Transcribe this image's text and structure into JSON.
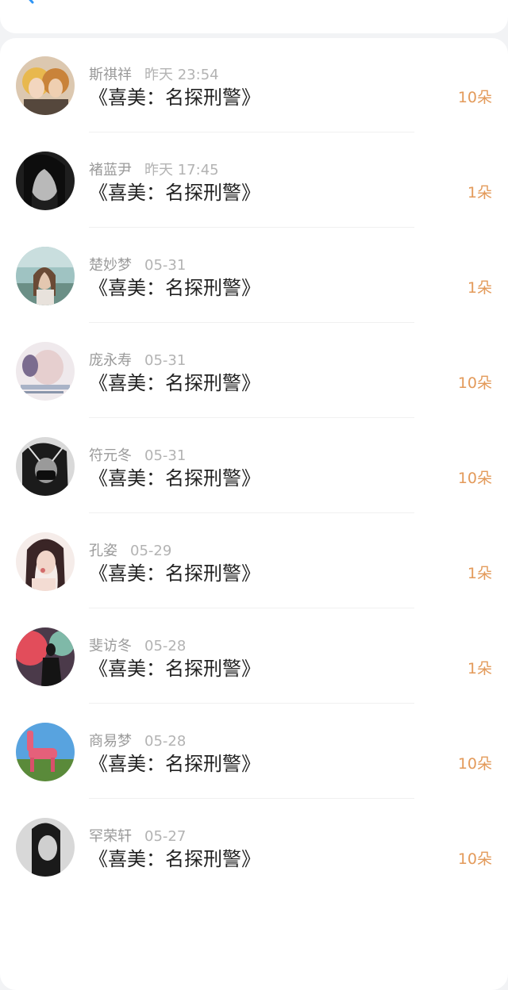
{
  "header": {
    "back_icon": "chevron-left-icon",
    "accent_color": "#2f95f5"
  },
  "records": [
    {
      "name": "斯祺祥",
      "time": "昨天 23:54",
      "title": "《喜美：名探刑警》",
      "amount": "10朵"
    },
    {
      "name": "褚蓝尹",
      "time": "昨天 17:45",
      "title": "《喜美：名探刑警》",
      "amount": "1朵"
    },
    {
      "name": "楚妙梦",
      "time": "05-31",
      "title": "《喜美：名探刑警》",
      "amount": "1朵"
    },
    {
      "name": "庞永寿",
      "time": "05-31",
      "title": "《喜美：名探刑警》",
      "amount": "10朵"
    },
    {
      "name": "符元冬",
      "time": "05-31",
      "title": "《喜美：名探刑警》",
      "amount": "10朵"
    },
    {
      "name": "孔姿",
      "time": "05-29",
      "title": "《喜美：名探刑警》",
      "amount": "1朵"
    },
    {
      "name": "斐访冬",
      "time": "05-28",
      "title": "《喜美：名探刑警》",
      "amount": "1朵"
    },
    {
      "name": "商易梦",
      "time": "05-28",
      "title": "《喜美：名探刑警》",
      "amount": "10朵"
    },
    {
      "name": "罕荣轩",
      "time": "05-27",
      "title": "《喜美：名探刑警》",
      "amount": "10朵"
    }
  ],
  "colors": {
    "amount": "#e39a5a",
    "name": "#9a9a9a",
    "title": "#222222"
  }
}
